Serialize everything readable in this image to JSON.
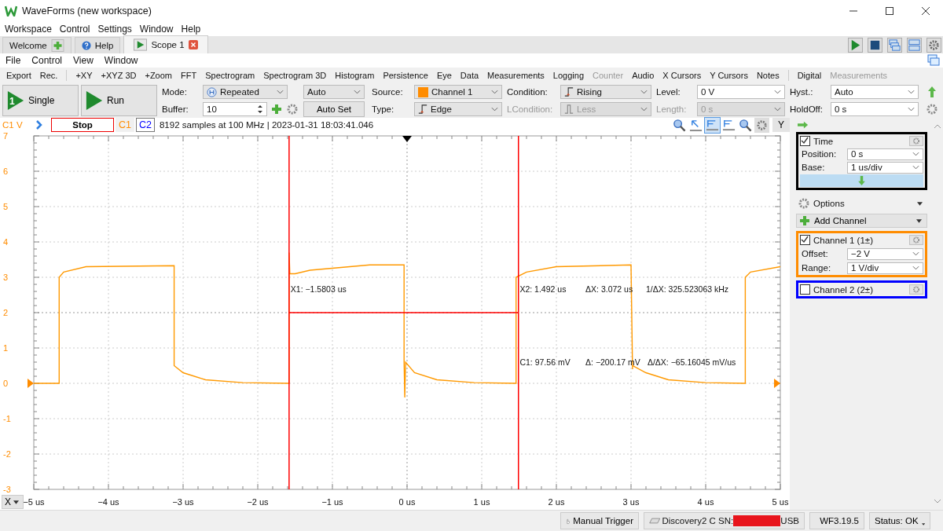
{
  "window": {
    "title": "WaveForms (new workspace)"
  },
  "menu": [
    "Workspace",
    "Control",
    "Settings",
    "Window",
    "Help"
  ],
  "tabs": [
    {
      "label": "Welcome",
      "kind": "plus",
      "selected": false,
      "closable": false
    },
    {
      "label": "Help",
      "kind": "help",
      "selected": false,
      "closable": false
    },
    {
      "label": "Scope 1",
      "kind": "play",
      "selected": true,
      "closable": true
    }
  ],
  "scope_menu": [
    "File",
    "Control",
    "View",
    "Window"
  ],
  "toolbar": [
    [
      {
        "label": "Export",
        "disabled": false
      },
      {
        "label": "Rec.",
        "disabled": false
      }
    ],
    [
      {
        "label": "+XY",
        "disabled": false
      },
      {
        "label": "+XYZ 3D",
        "disabled": false
      },
      {
        "label": "+Zoom",
        "disabled": false
      },
      {
        "label": "FFT",
        "disabled": false
      },
      {
        "label": "Spectrogram",
        "disabled": false
      },
      {
        "label": "Spectrogram 3D",
        "disabled": false
      },
      {
        "label": "Histogram",
        "disabled": false
      },
      {
        "label": "Persistence",
        "disabled": false
      },
      {
        "label": "Eye",
        "disabled": false
      },
      {
        "label": "Data",
        "disabled": false
      },
      {
        "label": "Measurements",
        "disabled": false
      },
      {
        "label": "Logging",
        "disabled": false
      },
      {
        "label": "Counter",
        "disabled": true
      },
      {
        "label": "Audio",
        "disabled": false
      },
      {
        "label": "X Cursors",
        "disabled": false
      },
      {
        "label": "Y Cursors",
        "disabled": false
      },
      {
        "label": "Notes",
        "disabled": false
      }
    ],
    [
      {
        "label": "Digital",
        "disabled": false
      },
      {
        "label": "Measurements",
        "disabled": true
      }
    ]
  ],
  "acquire": {
    "single": {
      "label": "Single",
      "badge": "1"
    },
    "run": {
      "label": "Run"
    },
    "mode": {
      "label": "Mode:",
      "value": "Repeated"
    },
    "auto": {
      "value": "Auto"
    },
    "buffer": {
      "label": "Buffer:",
      "value": "10"
    },
    "auto_set": {
      "label": "Auto Set"
    }
  },
  "trigger": {
    "source": {
      "label": "Source:",
      "value": "Channel 1",
      "color": "#ff8c00",
      "disabled": false
    },
    "type": {
      "label": "Type:",
      "value": "Edge",
      "disabled": false
    },
    "condition": {
      "label": "Condition:",
      "value": "Rising",
      "disabled": false
    },
    "lcondition": {
      "label": "LCondition:",
      "value": "Less",
      "disabled": true
    },
    "level": {
      "label": "Level:",
      "value": "0 V",
      "disabled": false
    },
    "length": {
      "label": "Length:",
      "value": "0 s",
      "disabled": true
    },
    "hyst": {
      "label": "Hyst.:",
      "value": "Auto",
      "disabled": false
    },
    "holdoff": {
      "label": "HoldOff:",
      "value": "0 s",
      "disabled": false
    }
  },
  "plot": {
    "y_unit": "C1 V",
    "stop": "Stop",
    "channel_buttons": [
      {
        "label": "C1",
        "color": "#ff8c00",
        "selected": false
      },
      {
        "label": "C2",
        "color": "#0000ff",
        "selected": true
      }
    ],
    "info": "8192 samples at 100 MHz | 2023-01-31 18:03:41.046",
    "tools": [
      {
        "kind": "zoom-in",
        "selected": false
      },
      {
        "kind": "pointer",
        "selected": false
      },
      {
        "kind": "cursor-bar",
        "selected": true
      },
      {
        "kind": "cursor-bar",
        "selected": false
      },
      {
        "kind": "zoom-out",
        "selected": false
      }
    ],
    "y_button": "Y",
    "x_button": "X",
    "chart_data": {
      "type": "line",
      "xlim": [
        -5,
        5
      ],
      "ylim": [
        -3,
        7
      ],
      "xticks": [
        {
          "value": -5,
          "label": "−5 us"
        },
        {
          "value": -4,
          "label": "−4 us"
        },
        {
          "value": -3,
          "label": "−3 us"
        },
        {
          "value": -2,
          "label": "−2 us"
        },
        {
          "value": -1,
          "label": "−1 us"
        },
        {
          "value": 0,
          "label": "0 us"
        },
        {
          "value": 1,
          "label": "1 us"
        },
        {
          "value": 2,
          "label": "2 us"
        },
        {
          "value": 3,
          "label": "3 us"
        },
        {
          "value": 4,
          "label": "4 us"
        },
        {
          "value": 5,
          "label": "5 us"
        }
      ],
      "yticks": [
        7,
        6,
        5,
        4,
        3,
        2,
        1,
        0,
        -1,
        -2,
        -3
      ],
      "x": [
        -5,
        -4.66,
        -4.66,
        -4.6,
        -4.3,
        -3.12,
        -3.12,
        -3.0,
        -2.7,
        -2.2,
        -1.58,
        -1.58,
        -1.57,
        -1.5,
        -1.3,
        -0.5,
        -0.04,
        -0.04,
        -0.03,
        -0.02,
        0.1,
        0.4,
        0.9,
        1.46,
        1.46,
        1.6,
        2.0,
        3.0,
        3.02,
        3.02,
        3.2,
        3.5,
        4.0,
        4.53,
        4.53,
        4.6,
        5
      ],
      "series": [
        {
          "color": "#ff9900",
          "values": [
            0,
            0,
            3.0,
            3.15,
            3.3,
            3.33,
            0.5,
            0.3,
            0.1,
            0.02,
            0,
            3.7,
            3.1,
            3.1,
            3.2,
            3.35,
            3.35,
            0.6,
            -0.4,
            0.6,
            0.3,
            0.1,
            0.02,
            0,
            3.0,
            3.15,
            3.3,
            3.35,
            0.4,
            0.5,
            0.3,
            0.1,
            0.02,
            0,
            3.0,
            3.15,
            3.3
          ]
        }
      ],
      "grid": true,
      "ref_lines": [
        {
          "axis": "x",
          "value": -1.5803,
          "color": "#ff0000"
        },
        {
          "axis": "x",
          "value": 1.492,
          "color": "#ff0000"
        },
        {
          "axis": "y",
          "value": 2,
          "color": "#ff0000"
        }
      ],
      "annotations": [
        "X1: −1.5803 us",
        "X2: 1.492 us",
        "ΔX: 3.072 us",
        "1/ΔX: 325.523063 kHz",
        "C1: 97.56 mV",
        "Δ: −200.17 mV",
        "Δ/ΔX: −65.16045 mV/us"
      ]
    }
  },
  "panel": {
    "time": {
      "title": "Time",
      "checked": true,
      "rows": [
        {
          "label": "Position:",
          "value": "0 s"
        },
        {
          "label": "Base:",
          "value": "1 us/div"
        }
      ]
    },
    "options": "Options",
    "add_channel": "Add Channel",
    "channels": [
      {
        "name": "Channel 1 (1±)",
        "checked": true,
        "color": "#ff8c00",
        "rows": [
          {
            "label": "Offset:",
            "value": "−2 V"
          },
          {
            "label": "Range:",
            "value": "1 V/div"
          }
        ]
      },
      {
        "name": "Channel 2 (2±)",
        "checked": false,
        "color": "#0000ff"
      }
    ]
  },
  "status_bar": [
    {
      "kind": "trigger",
      "label": "Manual Trigger"
    },
    {
      "kind": "device",
      "label": "Discovery2 C SN:",
      "suffix": "USB"
    },
    {
      "kind": "version",
      "label": "WF3.19.5"
    },
    {
      "kind": "status",
      "label": "Status: OK"
    }
  ]
}
